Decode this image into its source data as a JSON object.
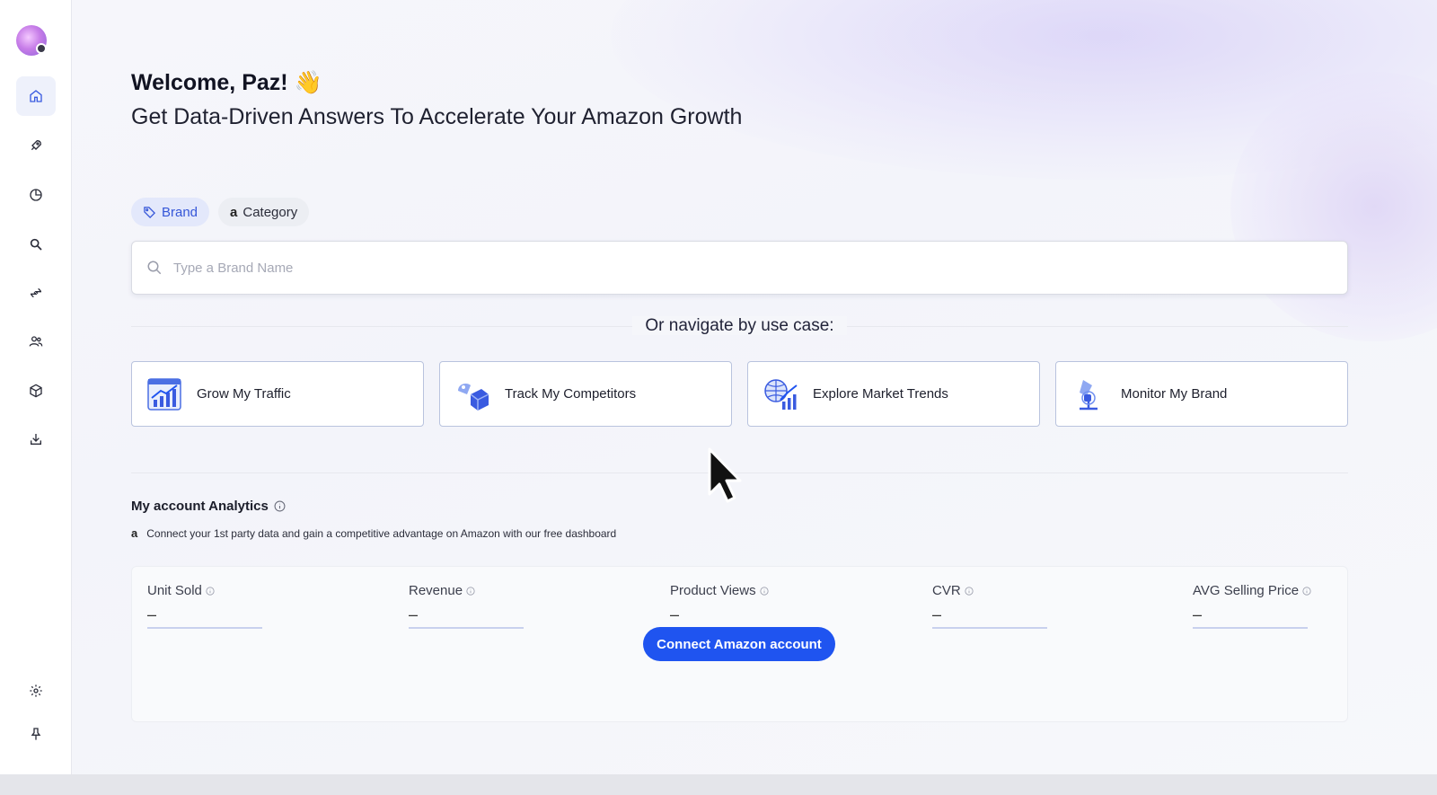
{
  "header": {
    "welcome": "Welcome, Paz! 👋",
    "subtitle": "Get Data-Driven Answers To Accelerate Your Amazon Growth"
  },
  "search_tabs": [
    {
      "label": "Brand",
      "icon": "tag-icon",
      "active": true
    },
    {
      "label": "Category",
      "icon": "amazon-icon",
      "active": false
    }
  ],
  "search": {
    "placeholder": "Type a Brand Name",
    "value": ""
  },
  "navigate": {
    "title": "Or navigate by use case:"
  },
  "use_cases": [
    {
      "label": "Grow My Traffic",
      "icon": "traffic-growth-icon"
    },
    {
      "label": "Track My Competitors",
      "icon": "competitors-icon"
    },
    {
      "label": "Explore Market Trends",
      "icon": "market-trends-icon"
    },
    {
      "label": "Monitor My Brand",
      "icon": "monitor-brand-icon"
    }
  ],
  "analytics": {
    "title": "My account Analytics",
    "description": "Connect your 1st party data and gain a competitive advantage on Amazon with our free dashboard",
    "metrics": [
      {
        "label": "Unit Sold",
        "value": "–"
      },
      {
        "label": "Revenue",
        "value": "–"
      },
      {
        "label": "Product Views",
        "value": "–"
      },
      {
        "label": "CVR",
        "value": "–"
      },
      {
        "label": "AVG Selling Price",
        "value": "–"
      }
    ],
    "connect_button": "Connect Amazon account"
  },
  "sidebar": {
    "items": [
      "home-icon",
      "rocket-icon",
      "pie-chart-icon",
      "search-icon",
      "compare-arrows-icon",
      "users-icon",
      "box-icon",
      "download-icon"
    ],
    "bottom_items": [
      "settings-icon",
      "pin-icon"
    ]
  },
  "colors": {
    "accent": "#1f54f0",
    "tab_active_bg": "#e3e8fb",
    "tab_active_text": "#3556d8",
    "card_border": "#b9c3de"
  }
}
